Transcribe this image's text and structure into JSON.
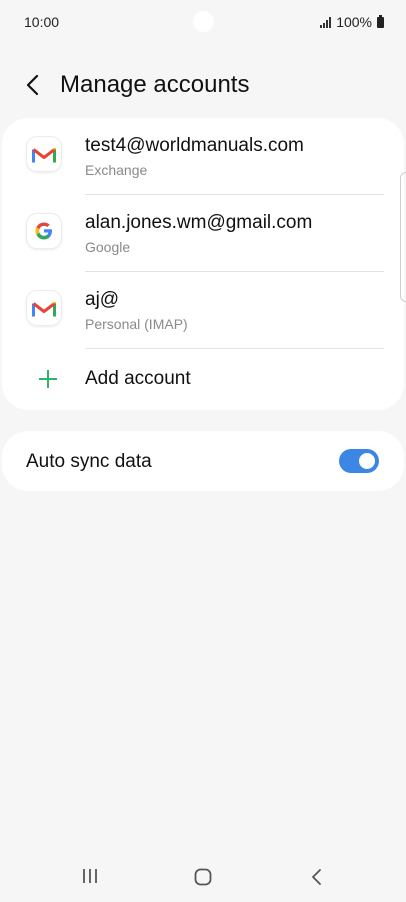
{
  "status_bar": {
    "time": "10:00",
    "battery": "100%",
    "icons": [
      "signal-icon",
      "battery-icon"
    ]
  },
  "header": {
    "title": "Manage accounts",
    "back_icon": "back-arrow-icon"
  },
  "accounts": [
    {
      "email": "test4@worldmanuals.com",
      "type": "Exchange",
      "icon": "gmail-icon"
    },
    {
      "email": "alan.jones.wm@gmail.com",
      "type": "Google",
      "icon": "google-icon"
    },
    {
      "email": "aj@",
      "type": "Personal (IMAP)",
      "icon": "gmail-icon"
    }
  ],
  "add_account": {
    "label": "Add account",
    "icon": "plus-icon"
  },
  "auto_sync": {
    "label": "Auto sync data",
    "enabled": true
  },
  "nav_bar": {
    "icons": [
      "recents-icon",
      "home-icon",
      "back-icon"
    ]
  },
  "colors": {
    "background": "#f6f6f6",
    "card": "#ffffff",
    "accent": "#3c86e6",
    "plus_green": "#2db46a",
    "secondary_text": "#8a8a8a"
  }
}
